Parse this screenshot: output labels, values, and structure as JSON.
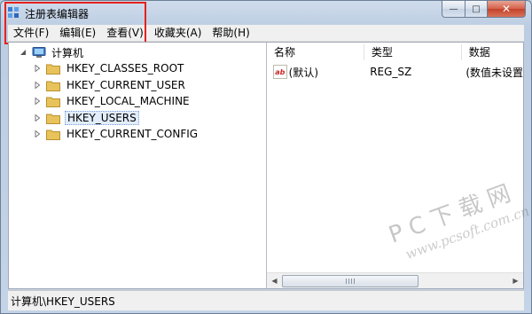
{
  "window": {
    "title": "注册表编辑器",
    "caption": {
      "minimize_label": "—",
      "maximize_label": "□",
      "close_label": "✕"
    }
  },
  "menubar": {
    "items": [
      "文件(F)",
      "编辑(E)",
      "查看(V)",
      "收藏夹(A)",
      "帮助(H)"
    ]
  },
  "tree": {
    "root": "计算机",
    "items": [
      {
        "label": "HKEY_CLASSES_ROOT",
        "selected": false
      },
      {
        "label": "HKEY_CURRENT_USER",
        "selected": false
      },
      {
        "label": "HKEY_LOCAL_MACHINE",
        "selected": false
      },
      {
        "label": "HKEY_USERS",
        "selected": true
      },
      {
        "label": "HKEY_CURRENT_CONFIG",
        "selected": false
      }
    ]
  },
  "list": {
    "columns": [
      "名称",
      "类型",
      "数据"
    ],
    "rows": [
      {
        "icon": "reg-string-icon",
        "icon_text": "ab",
        "name": "(默认)",
        "type": "REG_SZ",
        "data": "(数值未设置"
      }
    ]
  },
  "statusbar": {
    "path": "计算机\\HKEY_USERS"
  },
  "watermark": {
    "brand": "PC下载网",
    "url": "www.pcsoft.com.cn"
  },
  "colors": {
    "highlight_box": "#e5221c",
    "folder": "#e8c25a",
    "selected_bg": "#e2edfb"
  }
}
